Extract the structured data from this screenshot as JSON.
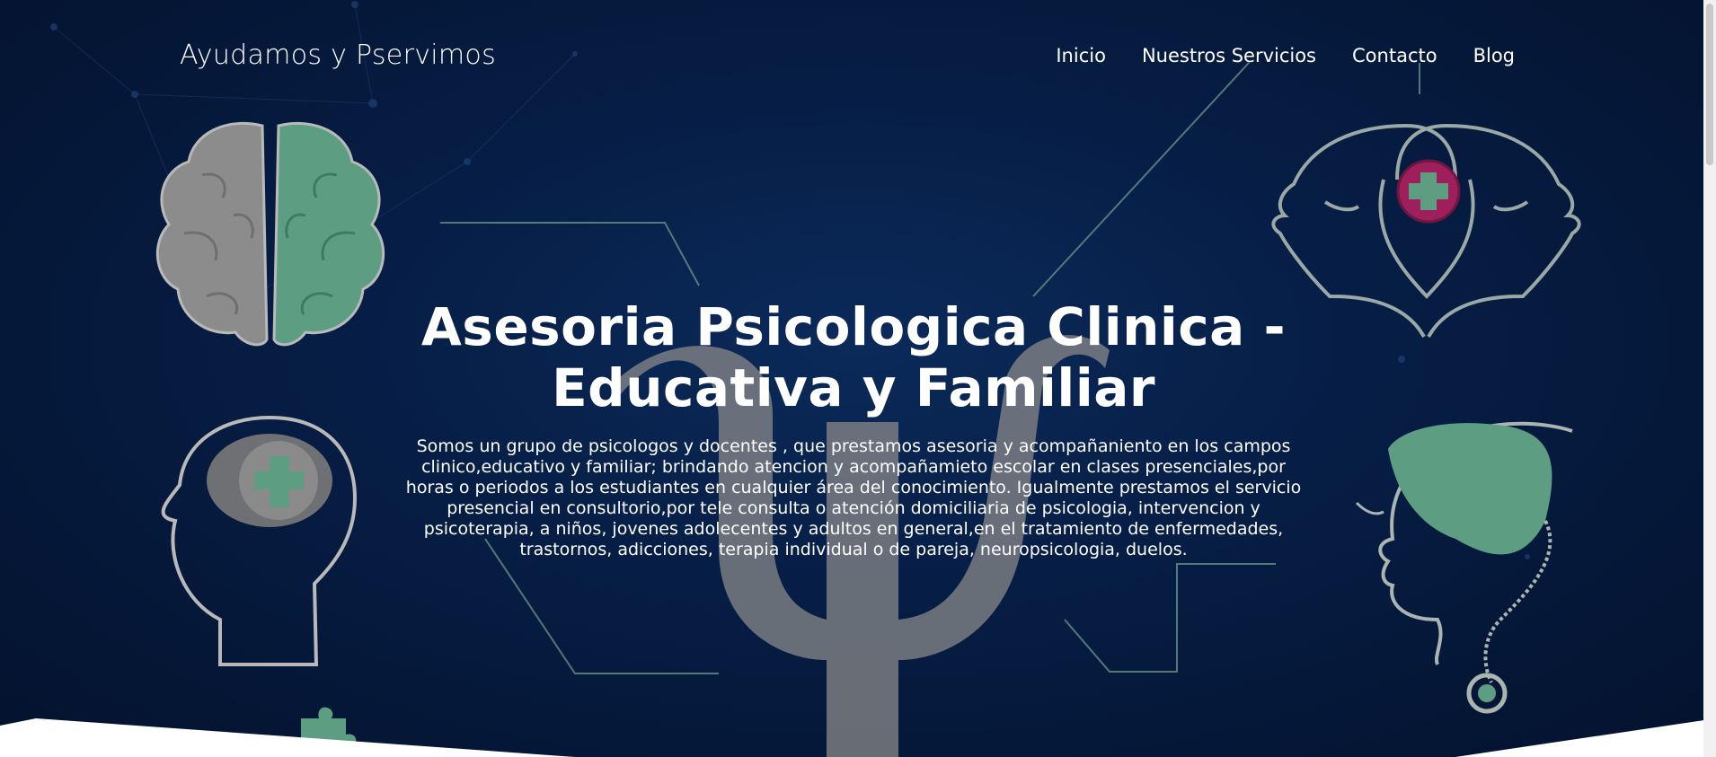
{
  "brand": {
    "name": "Ayudamos y Pservimos"
  },
  "nav": {
    "items": [
      {
        "label": "Inicio"
      },
      {
        "label": "Nuestros Servicios"
      },
      {
        "label": "Contacto"
      },
      {
        "label": "Blog"
      }
    ]
  },
  "hero": {
    "title": "Asesoria Psicologica Clinica - Educativa y Familiar",
    "description": "Somos un grupo de psicologos y docentes , que prestamos asesoria y acompañaniento en los campos clinico,educativo y familiar; brindando atencion y acompañamieto escolar en clases presenciales,por horas o periodos a los estudiantes en cualquier área del conocimiento. Igualmente prestamos el servicio presencial en consultorio,por tele consulta o atención domiciliaria de psicologia, intervencion y psicoterapia, a niños, jovenes adolecentes y adultos en general,en el tratamiento de enfermedades, trastornos, adicciones, terapia individual o de pareja, neuropsicologia, duelos."
  },
  "colors": {
    "background": "#061d44",
    "accent_green": "#5d9e83",
    "accent_magenta": "#9e1f5c",
    "line": "#7fa99a"
  },
  "icons": [
    "brain-icon",
    "head-cross-icon",
    "psi-symbol-icon",
    "two-faces-icon",
    "head-brain-stethoscope-icon",
    "puzzle-icon"
  ]
}
